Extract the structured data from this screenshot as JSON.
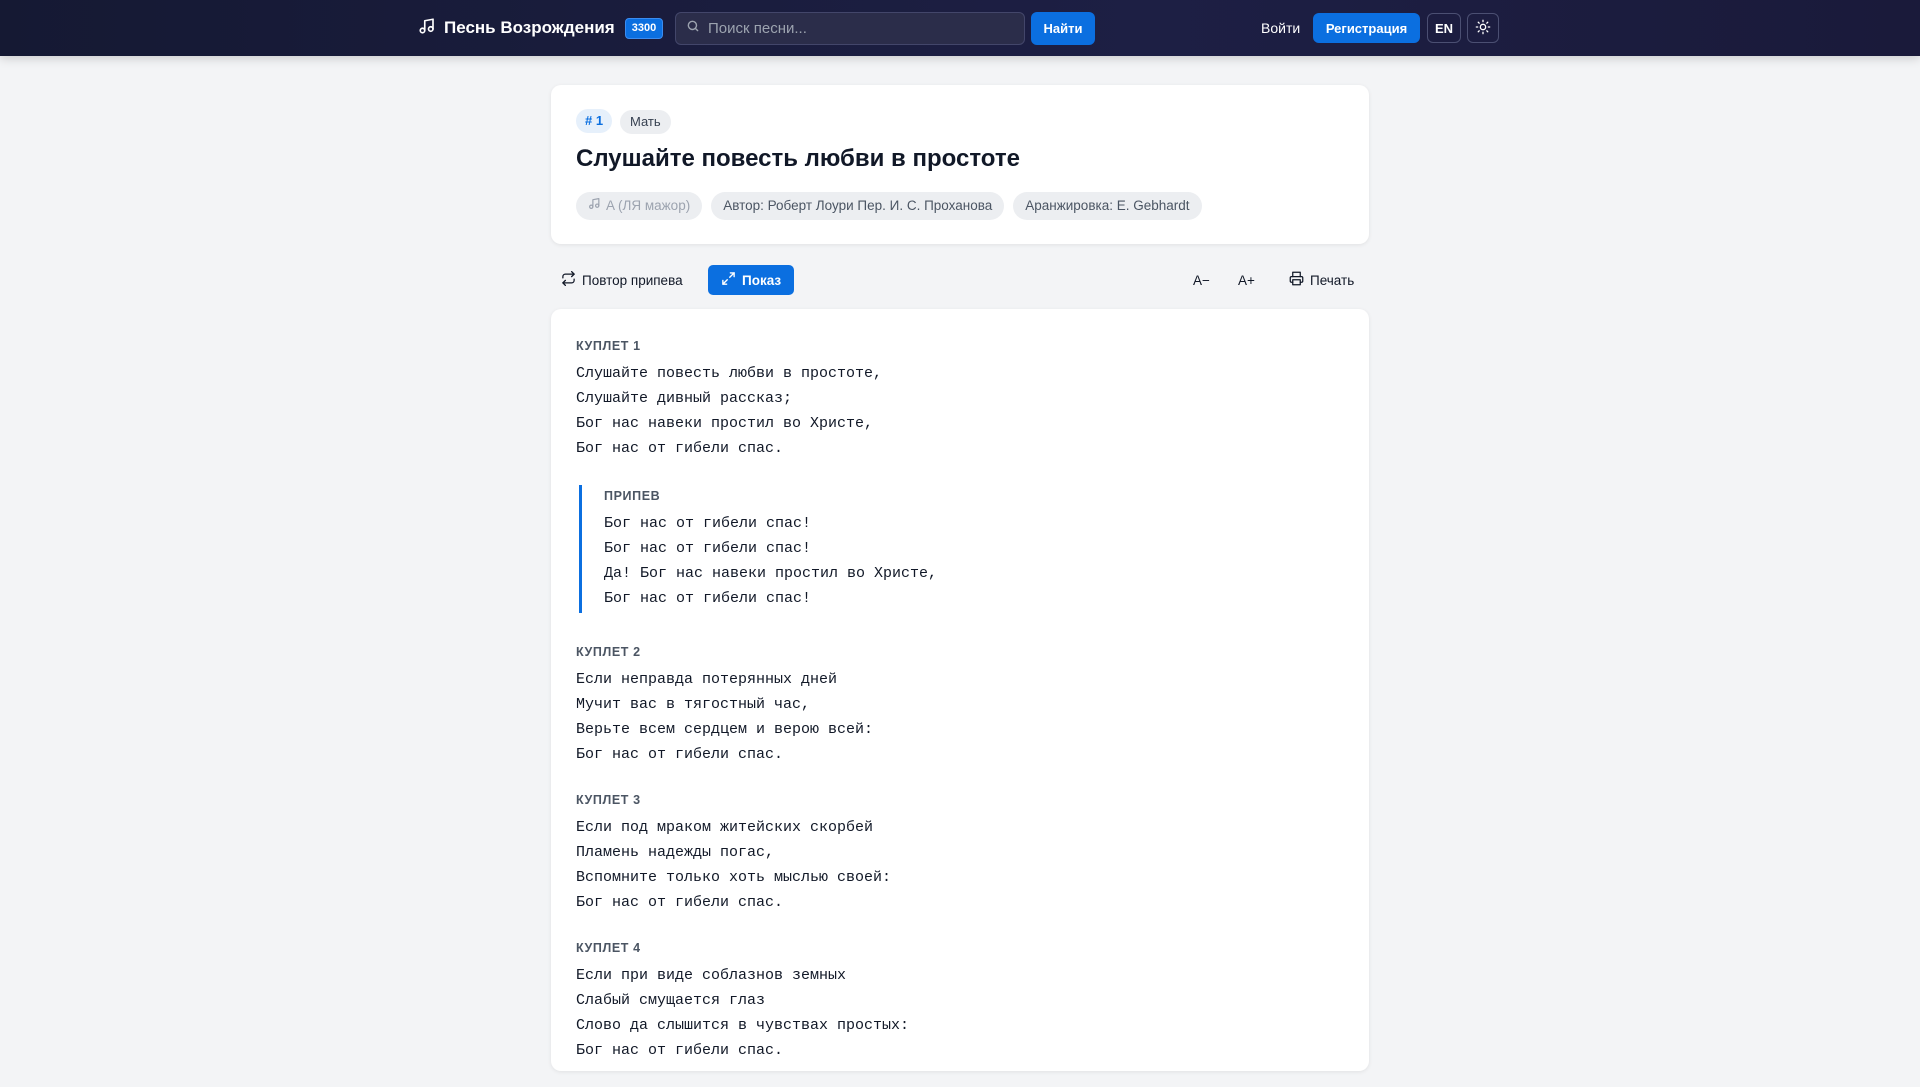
{
  "header": {
    "brand": "Песнь Возрождения",
    "badge": "3300",
    "search_placeholder": "Поиск песни...",
    "find_label": "Найти",
    "login_label": "Войти",
    "register_label": "Регистрация",
    "lang_label": "EN"
  },
  "song": {
    "number": "# 1",
    "category": "Мать",
    "title": "Слушайте повесть любви в простоте",
    "key": "A (ЛЯ мажор)",
    "author": "Автор: Роберт Лоури Пер. И. С. Проханова",
    "arrangement": "Аранжировка: E. Gebhardt"
  },
  "toolbar": {
    "repeat_label": "Повтор припева",
    "show_label": "Показ",
    "font_minus": "A−",
    "font_plus": "A+",
    "print_label": "Печать"
  },
  "lyrics": {
    "verse1": {
      "label": "КУПЛЕТ 1",
      "lines": [
        "Слушайте повесть любви в простоте,",
        "Слушайте дивный рассказ;",
        "Бог нас навеки простил во Христе,",
        "Бог нас от гибели спас."
      ]
    },
    "chorus": {
      "label": "ПРИПЕВ",
      "lines": [
        "Бог нас от гибели спас!",
        "Бог нас от гибели спас!",
        "Да! Бог нас навеки простил во Христе,",
        "Бог нас от гибели спас!"
      ]
    },
    "verse2": {
      "label": "КУПЛЕТ 2",
      "lines": [
        "Если неправда потерянных дней",
        "Мучит вас в тягостный час,",
        "Верьте всем сердцем и верою всей:",
        "Бог нас от гибели спас."
      ]
    },
    "verse3": {
      "label": "КУПЛЕТ 3",
      "lines": [
        "Если под мраком житейских скорбей",
        "Пламень надежды погас,",
        "Вспомните только хоть мыслью своей:",
        "Бог нас от гибели спас."
      ]
    },
    "verse4": {
      "label": "КУПЛЕТ 4",
      "lines": [
        "Если при виде соблазнов земных",
        "Слабый смущается глаз",
        "Слово да слышится в чувствах простых:",
        "Бог нас от гибели спас."
      ]
    }
  }
}
